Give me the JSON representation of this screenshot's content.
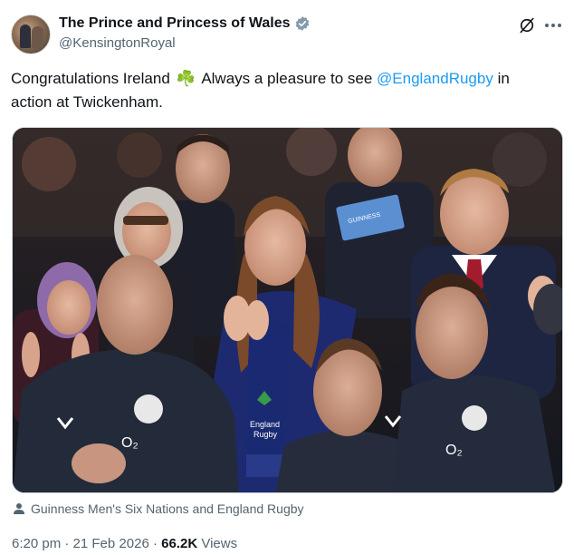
{
  "author": {
    "display_name": "The Prince and Princess of Wales",
    "handle": "@KensingtonRoyal",
    "verified_icon": "verified-badge-icon",
    "badge_color": "#829aab"
  },
  "tweet": {
    "text_before": "Congratulations Ireland",
    "emoji": "☘️",
    "text_middle": "Always a pleasure to see",
    "mention": "@EnglandRugby",
    "text_after_line1": "in",
    "text_line2": "action at Twickenham."
  },
  "media": {
    "program_text": "GUINNESS",
    "scarf_text_1": "England",
    "scarf_text_2": "Rugby",
    "jacket_mark": "O₂"
  },
  "caption": {
    "icon": "person-icon",
    "text": "Guinness Men's Six Nations and England Rugby"
  },
  "meta": {
    "time": "6:20 pm",
    "separator": "·",
    "date": "21 Feb 2026",
    "views_count": "66.2K",
    "views_label": "Views"
  },
  "colors": {
    "link": "#1d9bf0",
    "secondary_text": "#536471",
    "primary_text": "#0f1419"
  }
}
